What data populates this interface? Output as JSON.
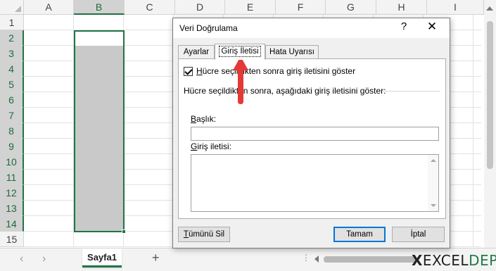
{
  "sheet": {
    "columns": [
      "A",
      "B",
      "C",
      "D",
      "E",
      "F",
      "G",
      "H",
      "I"
    ],
    "selected_column": "B",
    "rows": [
      "1",
      "2",
      "3",
      "4",
      "5",
      "6",
      "7",
      "8",
      "9",
      "10",
      "11",
      "12",
      "13",
      "14",
      "15"
    ],
    "selected_rows": [
      "2",
      "3",
      "4",
      "5",
      "6",
      "7",
      "8",
      "9",
      "10",
      "11",
      "12",
      "13",
      "14"
    ]
  },
  "tabbar": {
    "sheet_tab": "Sayfa1",
    "add_sheet": "+",
    "prev_arrow": "‹",
    "next_arrow": "›",
    "dots": "⋮"
  },
  "logo": {
    "x": "X",
    "excel": "EXCEL",
    "depo": "DEPO"
  },
  "dialog": {
    "title": "Veri Doğrulama",
    "help": "?",
    "close": "✕",
    "tabs": [
      {
        "label": "Ayarlar"
      },
      {
        "label": "Giriş İletisi",
        "active": true
      },
      {
        "label": "Hata Uyarısı"
      }
    ],
    "checkbox": {
      "label_u": "H",
      "label_rest": "ücre seçildikten sonra giriş iletisini göster",
      "checked": true
    },
    "group_label": "Hücre seçildikten sonra, aşağıdaki giriş iletisini göster:",
    "title_field": {
      "label_u": "B",
      "label_rest": "aşlık:",
      "value": ""
    },
    "message_field": {
      "label_u": "G",
      "label_rest": "iriş iletisi:",
      "value": ""
    },
    "buttons": {
      "clear_all_u": "T",
      "clear_all_rest": "ümünü Sil",
      "ok": "Tamam",
      "cancel": "İptal"
    }
  },
  "colors": {
    "accent": "#217346",
    "arrow": "#e53935",
    "focus": "#0078d7"
  }
}
